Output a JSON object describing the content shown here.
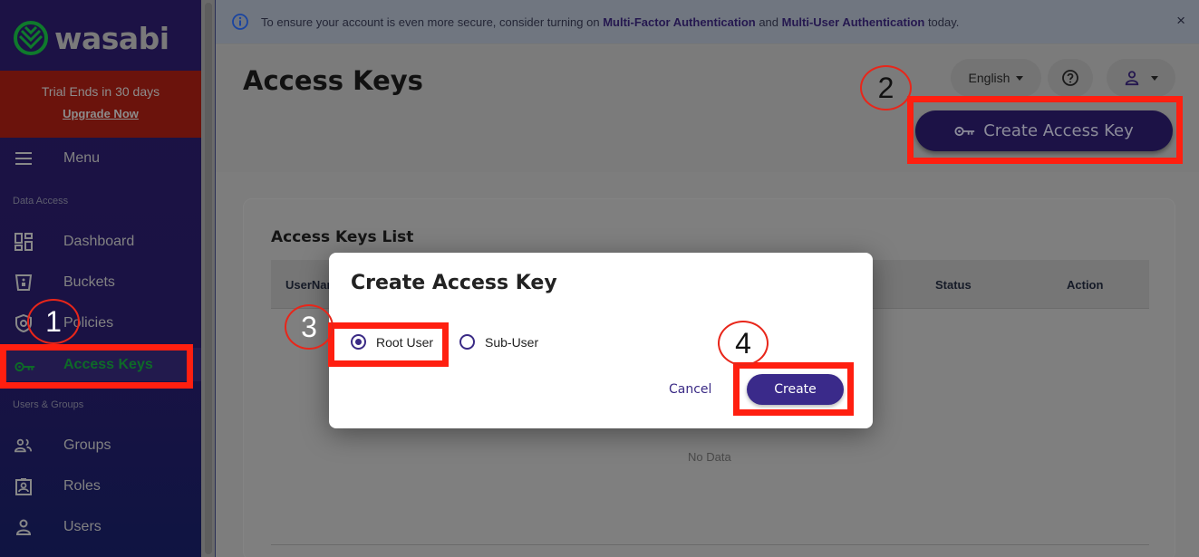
{
  "sidebar": {
    "logo_text": "wasabi",
    "trial_text": "Trial Ends in 30 days",
    "upgrade_link": "Upgrade Now",
    "menu_label": "Menu",
    "sections": [
      {
        "label": "Data Access"
      },
      {
        "label": "Users & Groups"
      }
    ],
    "items": [
      {
        "label": "Dashboard",
        "icon": "dashboard-icon"
      },
      {
        "label": "Buckets",
        "icon": "bucket-icon"
      },
      {
        "label": "Policies",
        "icon": "shield-icon"
      },
      {
        "label": "Access Keys",
        "icon": "key-icon",
        "active": true
      },
      {
        "label": "Groups",
        "icon": "group-icon"
      },
      {
        "label": "Roles",
        "icon": "badge-icon"
      },
      {
        "label": "Users",
        "icon": "user-icon"
      }
    ]
  },
  "banner": {
    "text_prefix": "To ensure your account is even more secure, consider turning on ",
    "link1": "Multi-Factor Authentication",
    "mid": " and ",
    "link2": "Multi-User Authentication",
    "suffix": " today.",
    "close": "×"
  },
  "header": {
    "title": "Access Keys",
    "language": "English",
    "create_button": "Create Access Key"
  },
  "card": {
    "title": "Access Keys List",
    "columns": [
      "UserName",
      "Status",
      "Action"
    ],
    "empty_text": "No Data"
  },
  "modal": {
    "title": "Create Access Key",
    "options": [
      {
        "label": "Root User",
        "checked": true
      },
      {
        "label": "Sub-User",
        "checked": false
      }
    ],
    "cancel": "Cancel",
    "create": "Create"
  },
  "annotations": {
    "step1": "1",
    "step2": "2",
    "step3": "3",
    "step4": "4",
    "color": "#ff1f10"
  },
  "colors": {
    "brand_dark": "#1c1246",
    "accent_purple": "#3a2a8a",
    "active_green": "#0e6a28",
    "trial_red": "#6b130c"
  }
}
